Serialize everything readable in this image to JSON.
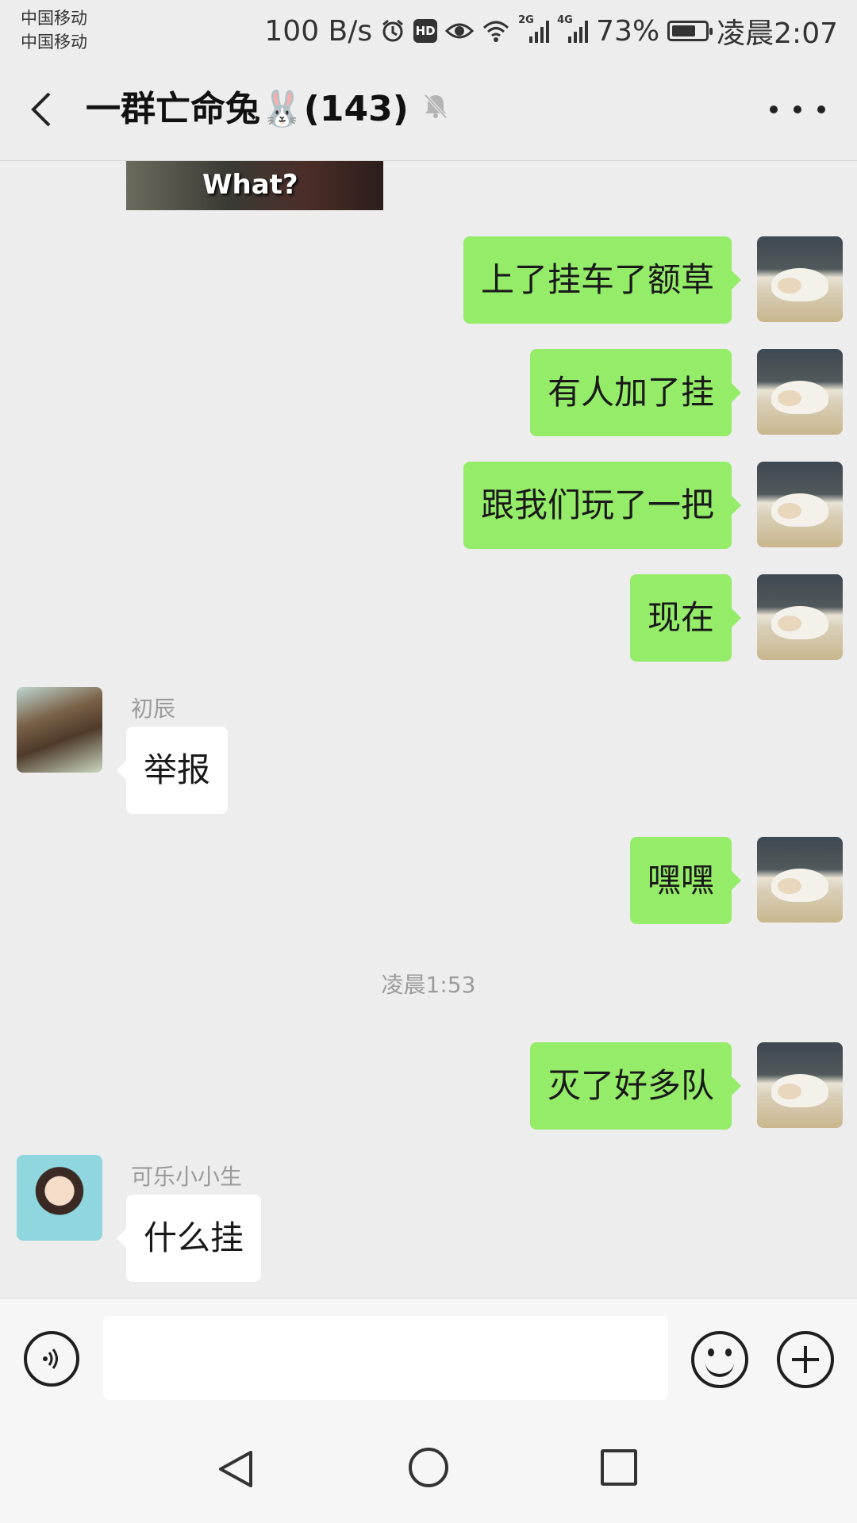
{
  "status_bar": {
    "carrier_1": "中国移动",
    "carrier_2": "中国移动",
    "net_speed": "100 B/s",
    "hd_badge": "HD",
    "sig1_label": "2G",
    "sig2_label": "4G",
    "battery_percent": "73%",
    "battery_level": 0.73,
    "time": "凌晨2:07"
  },
  "header": {
    "title": "一群亡命兔🐰(143)",
    "muted": true
  },
  "messages": {
    "image_caption": "What?",
    "m1": "上了挂车了额草",
    "m2": "有人加了挂",
    "m3": "跟我们玩了一把",
    "m4": "现在",
    "m5_sender": "初辰",
    "m5": "举报",
    "m6": "嘿嘿",
    "timestamp": "凌晨1:53",
    "m7": "灭了好多队",
    "m8_sender": "可乐小小生",
    "m8": "什么挂"
  },
  "input": {
    "placeholder": ""
  },
  "icons": {
    "back": "back-arrow-icon",
    "mute": "bell-muted-icon",
    "more": "more-icon",
    "voice": "voice-icon",
    "emoji": "emoji-icon",
    "plus": "plus-icon"
  },
  "colors": {
    "sent_bubble": "#95ec69",
    "received_bubble": "#ffffff",
    "background": "#ededed"
  }
}
